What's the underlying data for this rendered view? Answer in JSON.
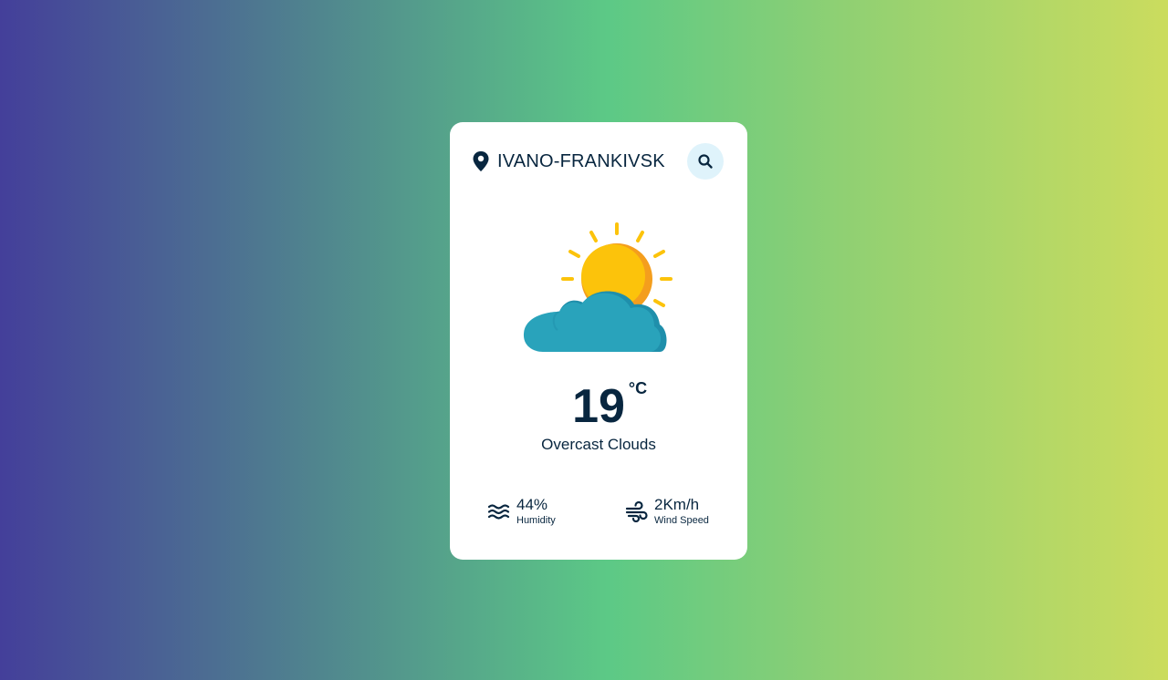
{
  "location": {
    "city": "IVANO-FRANKIVSK",
    "icon": "location-pin-icon"
  },
  "search": {
    "icon": "search-icon"
  },
  "weather": {
    "icon": "partly-cloudy-icon",
    "temperature": "19",
    "unit": "°C",
    "description": "Overcast Clouds"
  },
  "stats": {
    "humidity": {
      "value": "44%",
      "label": "Humidity",
      "icon": "humidity-waves-icon"
    },
    "wind": {
      "value": "2Km/h",
      "label": "Wind Speed",
      "icon": "wind-icon"
    }
  },
  "colors": {
    "text": "#08263f",
    "card": "#ffffff",
    "search_bg": "#dff3fb",
    "sun": "#fcc30b",
    "cloud": "#29a3bb"
  }
}
